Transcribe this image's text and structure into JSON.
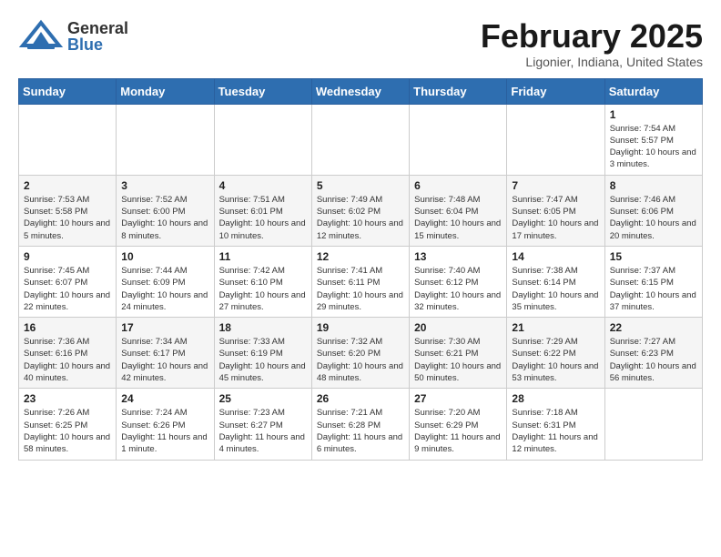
{
  "header": {
    "logo_general": "General",
    "logo_blue": "Blue",
    "month_title": "February 2025",
    "location": "Ligonier, Indiana, United States"
  },
  "days_of_week": [
    "Sunday",
    "Monday",
    "Tuesday",
    "Wednesday",
    "Thursday",
    "Friday",
    "Saturday"
  ],
  "weeks": [
    [
      {
        "day": "",
        "info": ""
      },
      {
        "day": "",
        "info": ""
      },
      {
        "day": "",
        "info": ""
      },
      {
        "day": "",
        "info": ""
      },
      {
        "day": "",
        "info": ""
      },
      {
        "day": "",
        "info": ""
      },
      {
        "day": "1",
        "info": "Sunrise: 7:54 AM\nSunset: 5:57 PM\nDaylight: 10 hours and 3 minutes."
      }
    ],
    [
      {
        "day": "2",
        "info": "Sunrise: 7:53 AM\nSunset: 5:58 PM\nDaylight: 10 hours and 5 minutes."
      },
      {
        "day": "3",
        "info": "Sunrise: 7:52 AM\nSunset: 6:00 PM\nDaylight: 10 hours and 8 minutes."
      },
      {
        "day": "4",
        "info": "Sunrise: 7:51 AM\nSunset: 6:01 PM\nDaylight: 10 hours and 10 minutes."
      },
      {
        "day": "5",
        "info": "Sunrise: 7:49 AM\nSunset: 6:02 PM\nDaylight: 10 hours and 12 minutes."
      },
      {
        "day": "6",
        "info": "Sunrise: 7:48 AM\nSunset: 6:04 PM\nDaylight: 10 hours and 15 minutes."
      },
      {
        "day": "7",
        "info": "Sunrise: 7:47 AM\nSunset: 6:05 PM\nDaylight: 10 hours and 17 minutes."
      },
      {
        "day": "8",
        "info": "Sunrise: 7:46 AM\nSunset: 6:06 PM\nDaylight: 10 hours and 20 minutes."
      }
    ],
    [
      {
        "day": "9",
        "info": "Sunrise: 7:45 AM\nSunset: 6:07 PM\nDaylight: 10 hours and 22 minutes."
      },
      {
        "day": "10",
        "info": "Sunrise: 7:44 AM\nSunset: 6:09 PM\nDaylight: 10 hours and 24 minutes."
      },
      {
        "day": "11",
        "info": "Sunrise: 7:42 AM\nSunset: 6:10 PM\nDaylight: 10 hours and 27 minutes."
      },
      {
        "day": "12",
        "info": "Sunrise: 7:41 AM\nSunset: 6:11 PM\nDaylight: 10 hours and 29 minutes."
      },
      {
        "day": "13",
        "info": "Sunrise: 7:40 AM\nSunset: 6:12 PM\nDaylight: 10 hours and 32 minutes."
      },
      {
        "day": "14",
        "info": "Sunrise: 7:38 AM\nSunset: 6:14 PM\nDaylight: 10 hours and 35 minutes."
      },
      {
        "day": "15",
        "info": "Sunrise: 7:37 AM\nSunset: 6:15 PM\nDaylight: 10 hours and 37 minutes."
      }
    ],
    [
      {
        "day": "16",
        "info": "Sunrise: 7:36 AM\nSunset: 6:16 PM\nDaylight: 10 hours and 40 minutes."
      },
      {
        "day": "17",
        "info": "Sunrise: 7:34 AM\nSunset: 6:17 PM\nDaylight: 10 hours and 42 minutes."
      },
      {
        "day": "18",
        "info": "Sunrise: 7:33 AM\nSunset: 6:19 PM\nDaylight: 10 hours and 45 minutes."
      },
      {
        "day": "19",
        "info": "Sunrise: 7:32 AM\nSunset: 6:20 PM\nDaylight: 10 hours and 48 minutes."
      },
      {
        "day": "20",
        "info": "Sunrise: 7:30 AM\nSunset: 6:21 PM\nDaylight: 10 hours and 50 minutes."
      },
      {
        "day": "21",
        "info": "Sunrise: 7:29 AM\nSunset: 6:22 PM\nDaylight: 10 hours and 53 minutes."
      },
      {
        "day": "22",
        "info": "Sunrise: 7:27 AM\nSunset: 6:23 PM\nDaylight: 10 hours and 56 minutes."
      }
    ],
    [
      {
        "day": "23",
        "info": "Sunrise: 7:26 AM\nSunset: 6:25 PM\nDaylight: 10 hours and 58 minutes."
      },
      {
        "day": "24",
        "info": "Sunrise: 7:24 AM\nSunset: 6:26 PM\nDaylight: 11 hours and 1 minute."
      },
      {
        "day": "25",
        "info": "Sunrise: 7:23 AM\nSunset: 6:27 PM\nDaylight: 11 hours and 4 minutes."
      },
      {
        "day": "26",
        "info": "Sunrise: 7:21 AM\nSunset: 6:28 PM\nDaylight: 11 hours and 6 minutes."
      },
      {
        "day": "27",
        "info": "Sunrise: 7:20 AM\nSunset: 6:29 PM\nDaylight: 11 hours and 9 minutes."
      },
      {
        "day": "28",
        "info": "Sunrise: 7:18 AM\nSunset: 6:31 PM\nDaylight: 11 hours and 12 minutes."
      },
      {
        "day": "",
        "info": ""
      }
    ]
  ]
}
